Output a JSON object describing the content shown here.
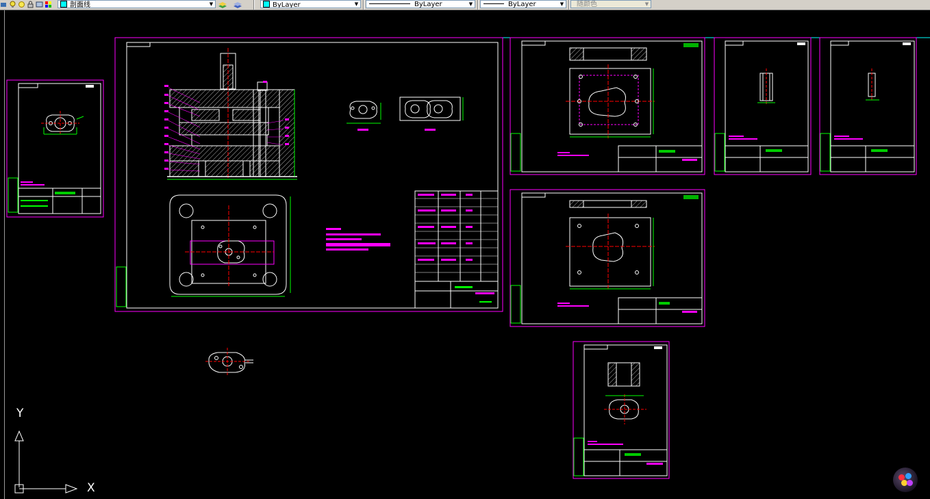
{
  "toolbar": {
    "layer_name": "剖面线",
    "color_value": "ByLayer",
    "linetype_value": "ByLayer",
    "lineweight_value": "ByLayer",
    "plotstyle_value": "随颜色"
  },
  "ucs": {
    "x_label": "X",
    "y_label": "Y"
  },
  "colors": {
    "frame": "#ff00ff",
    "geometry": "#ffffff",
    "dims": "#00ff00",
    "center": "#ff0000",
    "background": "#000000"
  }
}
